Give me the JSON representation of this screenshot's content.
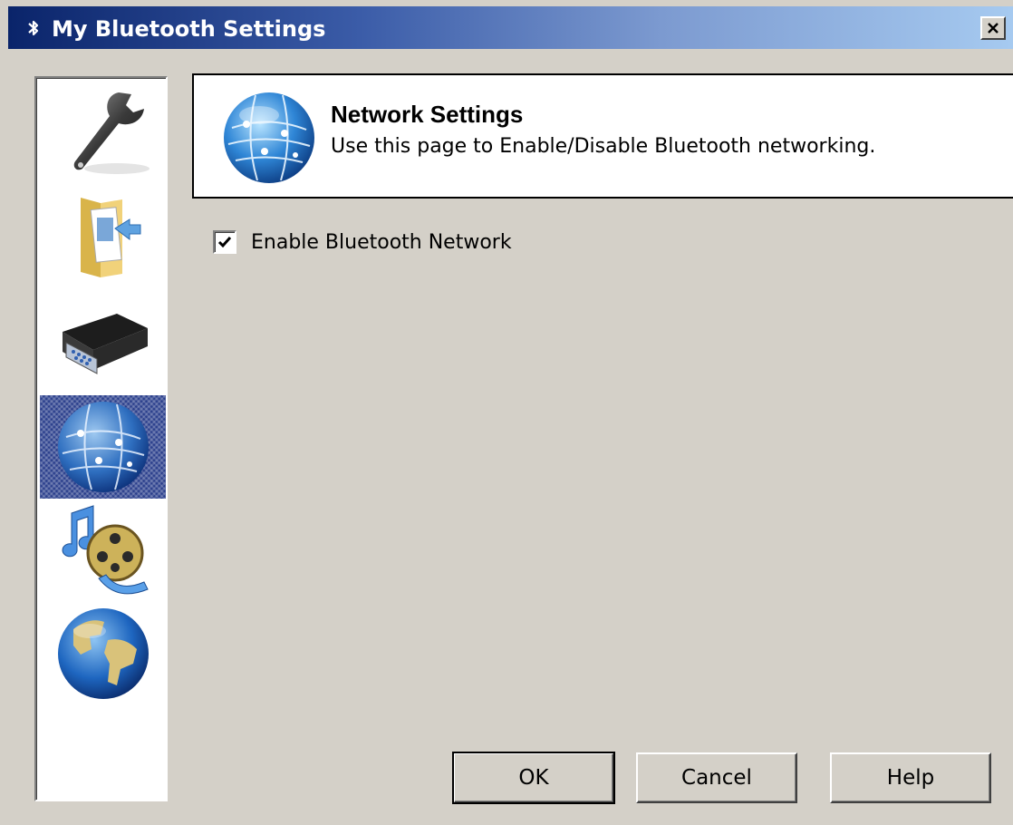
{
  "window": {
    "title": "My Bluetooth Settings",
    "close_glyph": "✕",
    "icons": {
      "app": "bluetooth-icon",
      "close": "close-icon"
    }
  },
  "sidebar": {
    "items": [
      {
        "icon": "wrench-icon",
        "selected": false
      },
      {
        "icon": "file-transfer-folder-icon",
        "selected": false
      },
      {
        "icon": "serial-port-icon",
        "selected": false
      },
      {
        "icon": "network-globe-icon",
        "selected": true
      },
      {
        "icon": "multimedia-icon",
        "selected": false
      },
      {
        "icon": "world-globe-icon",
        "selected": false
      }
    ]
  },
  "header": {
    "icon": "network-globe-icon",
    "title": "Network Settings",
    "description": "Use this page to Enable/Disable Bluetooth networking."
  },
  "options": {
    "enable_network": {
      "label": "Enable Bluetooth Network",
      "checked": true
    }
  },
  "buttons": {
    "ok": "OK",
    "cancel": "Cancel",
    "help": "Help"
  },
  "colors": {
    "titlebar_start": "#0a246a",
    "titlebar_end": "#a6caf0",
    "dialog_bg": "#d4d0c8",
    "selection": "#2b3f8c"
  }
}
